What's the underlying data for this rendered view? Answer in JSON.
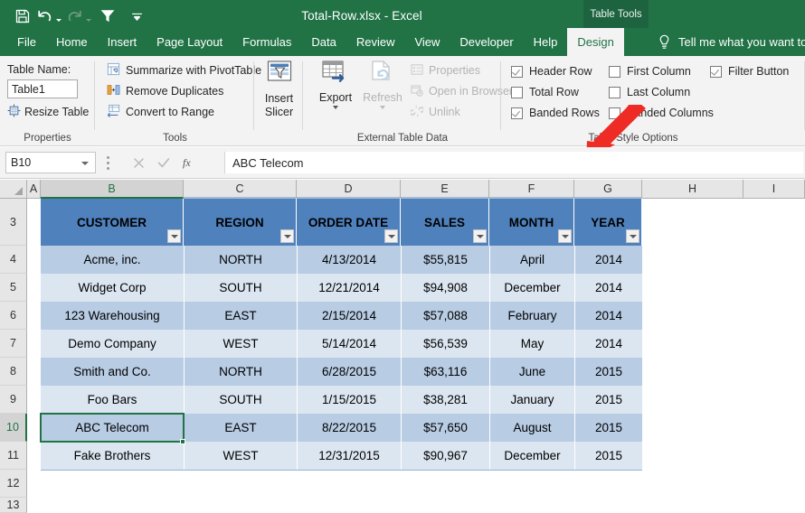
{
  "titlebar": {
    "document_title": "Total-Row.xlsx  -  Excel",
    "contextual_tab_group": "Table Tools",
    "qat": [
      {
        "name": "save-icon",
        "label": "Save"
      },
      {
        "name": "undo-icon",
        "label": "Undo"
      },
      {
        "name": "redo-icon",
        "label": "Redo"
      },
      {
        "name": "filter-icon",
        "label": "Filter"
      },
      {
        "name": "customize-qat-icon",
        "label": "Customize Quick Access Toolbar"
      }
    ]
  },
  "tabs": [
    {
      "label": "File",
      "active": false
    },
    {
      "label": "Home",
      "active": false
    },
    {
      "label": "Insert",
      "active": false
    },
    {
      "label": "Page Layout",
      "active": false
    },
    {
      "label": "Formulas",
      "active": false
    },
    {
      "label": "Data",
      "active": false
    },
    {
      "label": "Review",
      "active": false
    },
    {
      "label": "View",
      "active": false
    },
    {
      "label": "Developer",
      "active": false
    },
    {
      "label": "Help",
      "active": false
    },
    {
      "label": "Design",
      "active": true
    }
  ],
  "tellme": {
    "placeholder": "Tell me what you want to"
  },
  "ribbon": {
    "properties": {
      "group_label": "Properties",
      "table_name_label": "Table Name:",
      "table_name_value": "Table1",
      "resize_table_label": "Resize Table"
    },
    "tools": {
      "group_label": "Tools",
      "items": [
        {
          "label": "Summarize with PivotTable"
        },
        {
          "label": "Remove Duplicates"
        },
        {
          "label": "Convert to Range"
        }
      ]
    },
    "slicer": {
      "insert_slicer_label_line1": "Insert",
      "insert_slicer_label_line2": "Slicer"
    },
    "external_table_data": {
      "group_label": "External Table Data",
      "export_label": "Export",
      "refresh_label": "Refresh",
      "items": [
        {
          "label": "Properties",
          "disabled": true
        },
        {
          "label": "Open in Browser",
          "disabled": true
        },
        {
          "label": "Unlink",
          "disabled": true
        }
      ]
    },
    "table_style_options": {
      "group_label": "Table Style Options",
      "checkboxes": [
        {
          "label": "Header Row",
          "checked": true
        },
        {
          "label": "Total Row",
          "checked": false
        },
        {
          "label": "Banded Rows",
          "checked": true
        },
        {
          "label": "First Column",
          "checked": false
        },
        {
          "label": "Last Column",
          "checked": false
        },
        {
          "label": "Banded Columns",
          "checked": false
        },
        {
          "label": "Filter Button",
          "checked": true
        }
      ]
    }
  },
  "formula_bar": {
    "name_box_value": "B10",
    "cancel_label": "Cancel",
    "enter_label": "Enter",
    "insert_function_label": "fx",
    "formula_value": "ABC Telecom"
  },
  "grid": {
    "column_headers": [
      "A",
      "B",
      "C",
      "D",
      "E",
      "F",
      "G",
      "H",
      "I"
    ],
    "selected_column": "B",
    "selected_row": "10",
    "row_numbers": [
      "3",
      "4",
      "5",
      "6",
      "7",
      "8",
      "9",
      "10",
      "11",
      "12",
      "13"
    ],
    "table_headers": [
      "CUSTOMER",
      "REGION",
      "ORDER DATE",
      "SALES",
      "MONTH",
      "YEAR"
    ],
    "rows": [
      {
        "row": "4",
        "customer": "Acme, inc.",
        "region": "NORTH",
        "order_date": "4/13/2014",
        "sales": "$55,815",
        "month": "April",
        "year": "2014"
      },
      {
        "row": "5",
        "customer": "Widget Corp",
        "region": "SOUTH",
        "order_date": "12/21/2014",
        "sales": "$94,908",
        "month": "December",
        "year": "2014"
      },
      {
        "row": "6",
        "customer": "123 Warehousing",
        "region": "EAST",
        "order_date": "2/15/2014",
        "sales": "$57,088",
        "month": "February",
        "year": "2014"
      },
      {
        "row": "7",
        "customer": "Demo Company",
        "region": "WEST",
        "order_date": "5/14/2014",
        "sales": "$56,539",
        "month": "May",
        "year": "2014"
      },
      {
        "row": "8",
        "customer": "Smith and Co.",
        "region": "NORTH",
        "order_date": "6/28/2015",
        "sales": "$63,116",
        "month": "June",
        "year": "2015"
      },
      {
        "row": "9",
        "customer": "Foo Bars",
        "region": "SOUTH",
        "order_date": "1/15/2015",
        "sales": "$38,281",
        "month": "January",
        "year": "2015"
      },
      {
        "row": "10",
        "customer": "ABC Telecom",
        "region": "EAST",
        "order_date": "8/22/2015",
        "sales": "$57,650",
        "month": "August",
        "year": "2015"
      },
      {
        "row": "11",
        "customer": "Fake Brothers",
        "region": "WEST",
        "order_date": "12/31/2015",
        "sales": "$90,967",
        "month": "December",
        "year": "2015"
      }
    ],
    "selected_cell": "B10",
    "selected_cell_value": "ABC Telecom"
  },
  "annotation": {
    "arrow_color": "#ee2b24",
    "points_to": "Total Row"
  },
  "colors": {
    "excel_green": "#217346",
    "table_header_blue": "#4f81bd",
    "band_dark": "#b8cce4",
    "band_light": "#dce6f1"
  }
}
